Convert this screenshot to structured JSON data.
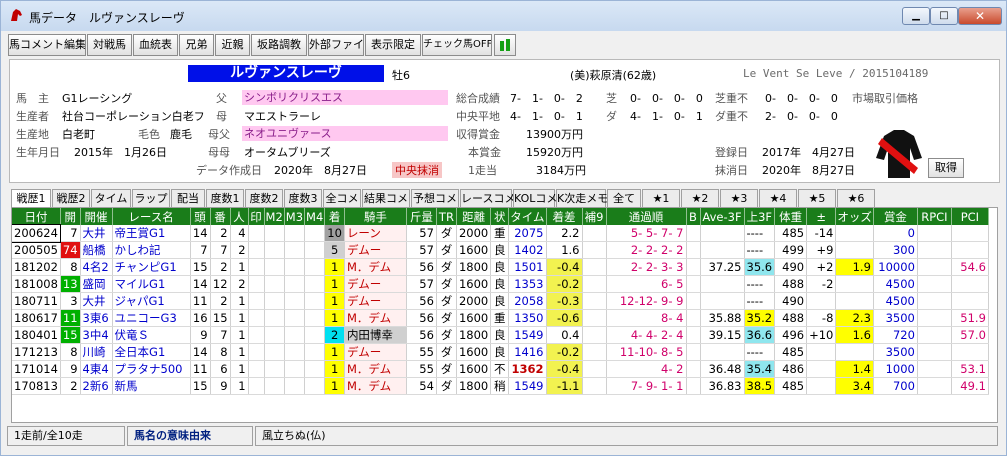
{
  "window": {
    "title": "馬データ　ルヴァンスレーヴ",
    "controls": {
      "minimize": "▁",
      "maximize": "□",
      "close": "✕"
    },
    "icon": "horse-head-icon"
  },
  "toolbar": {
    "buttons": [
      "馬コメント編集",
      "対戦馬",
      "血統表",
      "兄弟",
      "近親",
      "坂路調教",
      "外部ファイル",
      "表示限定",
      "チェック馬OFF"
    ],
    "extra_icon": "green-bar-icon"
  },
  "horse": {
    "name": "ルヴァンスレーヴ",
    "sex_age": "牡6",
    "trainer": "(美)萩原清(62歳)",
    "roman_name": "Le Vent Se Leve / 2015104189",
    "owner_label": "馬　主",
    "owner": "G1レーシング",
    "breeder_label": "生産者",
    "breeder": "社台コーポレーション白老フ",
    "birthplace_label": "生産地",
    "birthplace": "白老町",
    "coat_label": "毛色",
    "coat": "鹿毛",
    "birthday_label": "生年月日",
    "birthday": "2015年　1月26日",
    "sire_label": "父",
    "sire": "シンボリクリスエス",
    "dam_label": "母",
    "dam": "マエストラーレ",
    "damsire_label": "母父",
    "damsire": "ネオユニヴァース",
    "damdam_label": "母母",
    "damdam": "オータムブリーズ",
    "created_label": "データ作成日",
    "created": "2020年　8月27日",
    "status": "中央抹消",
    "record_label": "総合成績",
    "record": "7-　1-　0-　2",
    "turf_label": "芝",
    "turf": "0-　0-　0-　0",
    "turf_heavy_label": "芝重不",
    "turf_heavy": "0-　0-　0-　0",
    "market_label": "市場取引価格",
    "central_label": "中央平地",
    "central": "4-　1-　0-　1",
    "dirt_label": "ダ",
    "dirt": "4-　1-　0-　1",
    "dirt_heavy_label": "ダ重不",
    "dirt_heavy": "2-　0-　0-　0",
    "earnings_label": "収得賞金",
    "earnings": "13900万円",
    "prize_label": "本賞金",
    "prize": "15920万円",
    "perrun_label": "1走当",
    "perrun": "3184万円",
    "registered_label": "登録日",
    "registered": "2017年　4月27日",
    "deleted_label": "抹消日",
    "deleted": "2020年　8月27日",
    "get_button": "取得"
  },
  "tabs": [
    "戦歴1",
    "戦歴2",
    "タイム",
    "ラップ",
    "配当",
    "度数1",
    "度数2",
    "度数3",
    "全コメ",
    "結果コメ",
    "予想コメ",
    "レースコメ",
    "KOLコメ",
    "K次走メモ",
    "全て",
    "★1",
    "★2",
    "★3",
    "★4",
    "★5",
    "★6"
  ],
  "table": {
    "headers": [
      "日付",
      "開",
      "開催",
      "レース名",
      "頭",
      "番",
      "人",
      "印",
      "M2",
      "M3",
      "M4",
      "着",
      "騎手",
      "斤量",
      "TR",
      "距離",
      "状",
      "タイム",
      "着差",
      "補9",
      "通過順",
      "B",
      "Ave-3F",
      "上3F",
      "体重",
      "±",
      "オッズ",
      "賞金",
      "RPCI",
      "PCI"
    ],
    "rows": [
      [
        "200624",
        "7",
        "大井",
        "帝王賞G1",
        "14",
        "2",
        "4",
        "",
        "",
        "",
        "",
        "10",
        "レーン",
        "57",
        "ダ",
        "2000",
        "重",
        "2075",
        "2.2",
        "",
        "5- 5- 7- 7",
        "",
        "",
        "----",
        "485",
        "-14",
        "",
        "0",
        "",
        ""
      ],
      [
        "200505",
        "74",
        "船橋",
        "かしわ記",
        "7",
        "7",
        "2",
        "",
        "",
        "",
        "",
        "5",
        "デムー",
        "57",
        "ダ",
        "1600",
        "良",
        "1402",
        "1.6",
        "",
        "2- 2- 2- 2",
        "",
        "",
        "----",
        "499",
        "+9",
        "",
        "300",
        "",
        ""
      ],
      [
        "181202",
        "8",
        "4名2",
        "チャンピG1",
        "15",
        "2",
        "1",
        "",
        "",
        "",
        "",
        "1",
        "M．デム",
        "56",
        "ダ",
        "1800",
        "良",
        "1501",
        "-0.4",
        "",
        "2- 2- 3- 3",
        "",
        "37.25",
        "35.6",
        "490",
        "+2",
        "1.9",
        "10000",
        "",
        "54.6"
      ],
      [
        "181008",
        "13",
        "盛岡",
        "マイルG1",
        "14",
        "12",
        "2",
        "",
        "",
        "",
        "",
        "1",
        "デムー",
        "57",
        "ダ",
        "1600",
        "良",
        "1353",
        "-0.2",
        "",
        "6- 5",
        "",
        "",
        "----",
        "488",
        "-2",
        "",
        "4500",
        "",
        ""
      ],
      [
        "180711",
        "3",
        "大井",
        "ジャパG1",
        "11",
        "2",
        "1",
        "",
        "",
        "",
        "",
        "1",
        "デムー",
        "56",
        "ダ",
        "2000",
        "良",
        "2058",
        "-0.3",
        "",
        "12-12- 9- 9",
        "",
        "",
        "----",
        "490",
        "",
        "",
        "4500",
        "",
        ""
      ],
      [
        "180617",
        "11",
        "3東6",
        "ユニコーG3",
        "16",
        "15",
        "1",
        "",
        "",
        "",
        "",
        "1",
        "M．デム",
        "56",
        "ダ",
        "1600",
        "重",
        "1350",
        "-0.6",
        "",
        "8- 4",
        "",
        "35.88",
        "35.2",
        "488",
        "-8",
        "2.3",
        "3500",
        "",
        "51.9"
      ],
      [
        "180401",
        "15",
        "3中4",
        "伏竜Ｓ",
        "9",
        "7",
        "1",
        "",
        "",
        "",
        "",
        "2",
        "内田博幸",
        "56",
        "ダ",
        "1800",
        "良",
        "1549",
        "0.4",
        "",
        "4- 4- 2- 4",
        "",
        "39.15",
        "36.6",
        "496",
        "+10",
        "1.6",
        "720",
        "",
        "57.0"
      ],
      [
        "171213",
        "8",
        "川崎",
        "全日本G1",
        "14",
        "8",
        "1",
        "",
        "",
        "",
        "",
        "1",
        "デムー",
        "55",
        "ダ",
        "1600",
        "良",
        "1416",
        "-0.2",
        "",
        "11-10- 8- 5",
        "",
        "",
        "----",
        "485",
        "",
        "",
        "3500",
        "",
        ""
      ],
      [
        "171014",
        "9",
        "4東4",
        "プラタナ500",
        "11",
        "6",
        "1",
        "",
        "",
        "",
        "",
        "1",
        "M．デム",
        "55",
        "ダ",
        "1600",
        "不",
        "1362",
        "-0.4",
        "",
        "4- 2",
        "",
        "36.48",
        "35.4",
        "486",
        "",
        "1.4",
        "1000",
        "",
        "53.1"
      ],
      [
        "170813",
        "2",
        "2新6",
        "新馬",
        "15",
        "9",
        "1",
        "",
        "",
        "",
        "",
        "1",
        "M．デム",
        "54",
        "ダ",
        "1800",
        "稍",
        "1549",
        "-1.1",
        "",
        "7- 9- 1- 1",
        "",
        "36.83",
        "38.5",
        "485",
        "",
        "3.4",
        "700",
        "",
        "49.1"
      ]
    ]
  },
  "status": {
    "count": "1走前/全10走",
    "label": "馬名の意味由来",
    "meaning": "風立ちぬ(仏)"
  }
}
